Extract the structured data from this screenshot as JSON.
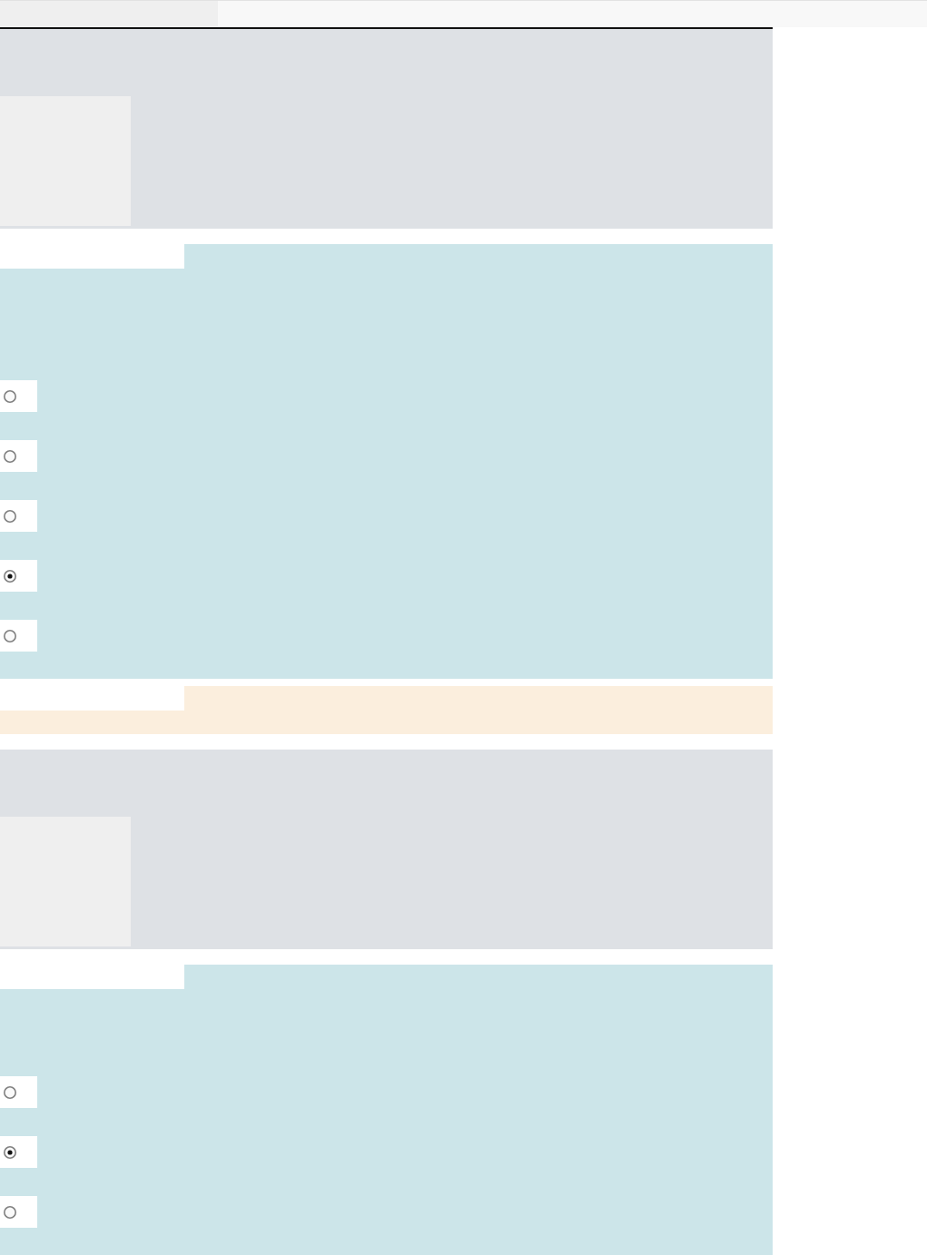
{
  "sections": [
    {
      "kind": "prompt"
    },
    {
      "kind": "choices",
      "options": [
        {
          "selected": false
        },
        {
          "selected": false
        },
        {
          "selected": false
        },
        {
          "selected": true
        },
        {
          "selected": false
        }
      ]
    },
    {
      "kind": "note"
    },
    {
      "kind": "prompt"
    },
    {
      "kind": "choices",
      "options": [
        {
          "selected": false
        },
        {
          "selected": true
        },
        {
          "selected": false
        }
      ]
    }
  ]
}
